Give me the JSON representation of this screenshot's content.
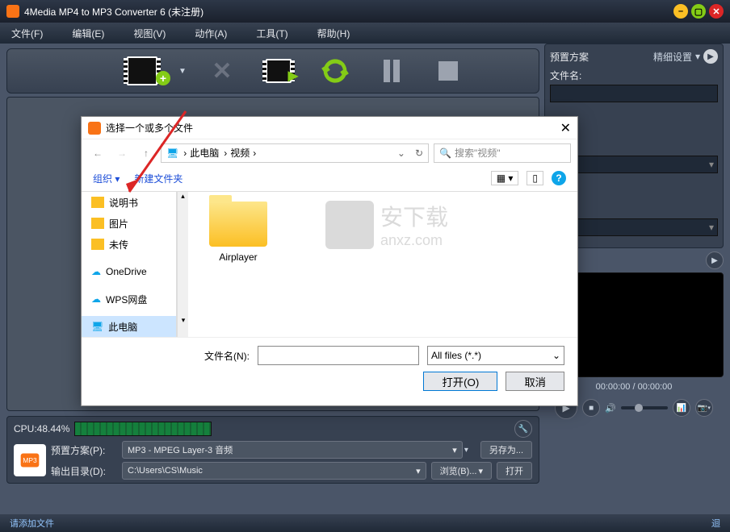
{
  "titlebar": {
    "title": "4Media MP4 to MP3 Converter 6 (未注册)"
  },
  "menu": {
    "file": "文件(F)",
    "edit": "编辑(E)",
    "view": "视图(V)",
    "action": "动作(A)",
    "tools": "工具(T)",
    "help": "帮助(H)"
  },
  "sidebar": {
    "preset_title": "预置方案",
    "advanced": "精细设置",
    "filename_label": "文件名:"
  },
  "preview": {
    "time": "00:00:00 / 00:00:00"
  },
  "cpu": {
    "label": "CPU:48.44%"
  },
  "profile": {
    "preset_label": "预置方案(P):",
    "preset_value": "MP3 - MPEG Layer-3 音频",
    "saveas": "另存为...",
    "output_label": "输出目录(D):",
    "output_value": "C:\\Users\\CS\\Music",
    "browse": "浏览(B)...",
    "open": "打开"
  },
  "status": {
    "left": "请添加文件",
    "right": "迴"
  },
  "dialog": {
    "title": "选择一个或多个文件",
    "path": {
      "pc": "此电脑",
      "folder": "视频"
    },
    "search_placeholder": "搜索\"视频\"",
    "organize": "组织",
    "newfolder": "新建文件夹",
    "tree": {
      "docs": "说明书",
      "pics": "图片",
      "unsent": "未传",
      "onedrive": "OneDrive",
      "wps": "WPS网盘",
      "thispc": "此电脑"
    },
    "content": {
      "folder1": "Airplayer"
    },
    "filename_label": "文件名(N):",
    "filter": "All files (*.*)",
    "open_btn": "打开(O)",
    "cancel_btn": "取消"
  },
  "watermark": {
    "text1": "安下载",
    "text2": "anxz.com"
  }
}
